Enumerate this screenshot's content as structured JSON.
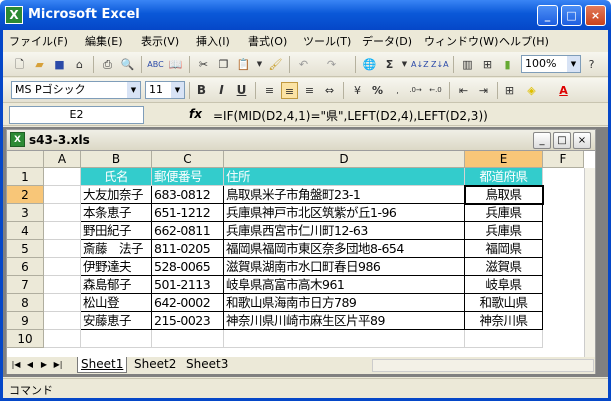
{
  "app": {
    "title": "Microsoft Excel",
    "icon_label": "X"
  },
  "window_buttons": {
    "minimize": "_",
    "maximize": "□",
    "close": "×"
  },
  "menu": [
    "ファイル(F)",
    "編集(E)",
    "表示(V)",
    "挿入(I)",
    "書式(O)",
    "ツール(T)",
    "データ(D)",
    "ウィンドウ(W)",
    "ヘルプ(H)"
  ],
  "toolbar": {
    "zoom": "100%",
    "sigma": "Σ"
  },
  "format_toolbar": {
    "font": "MS Pゴシック",
    "size": "11",
    "bold": "B",
    "italic": "I",
    "underline": "U",
    "percent": "%",
    "font_color_label": "A"
  },
  "formula_bar": {
    "namebox": "E2",
    "fx": "fx",
    "formula": "=IF(MID(D2,4,1)=\"県\",LEFT(D2,4),LEFT(D2,3))"
  },
  "workbook": {
    "title": "s43-3.xls",
    "icon_label": "X"
  },
  "columns": [
    "A",
    "B",
    "C",
    "D",
    "E",
    "F"
  ],
  "rows": [
    "1",
    "2",
    "3",
    "4",
    "5",
    "6",
    "7",
    "8",
    "9",
    "10"
  ],
  "table": {
    "headers": [
      "氏名",
      "郵便番号",
      "住所",
      "都道府県"
    ],
    "data": [
      [
        "大友加奈子",
        "683-0812",
        "鳥取県米子市角盤町23-1",
        "鳥取県"
      ],
      [
        "本条恵子",
        "651-1212",
        "兵庫県神戸市北区筑紫が丘1-96",
        "兵庫県"
      ],
      [
        "野田紀子",
        "662-0811",
        "兵庫県西宮市仁川町12-63",
        "兵庫県"
      ],
      [
        "斎藤　法子",
        "811-0205",
        "福岡県福岡市東区奈多団地8-654",
        "福岡県"
      ],
      [
        "伊野達夫",
        "528-0065",
        "滋賀県湖南市水口町春日986",
        "滋賀県"
      ],
      [
        "森島郁子",
        "501-2113",
        "岐阜県高富市高木961",
        "岐阜県"
      ],
      [
        "松山登",
        "642-0002",
        "和歌山県海南市日方789",
        "和歌山県"
      ],
      [
        "安藤恵子",
        "215-0023",
        "神奈川県川崎市麻生区片平89",
        "神奈川県"
      ]
    ]
  },
  "sheets": [
    "Sheet1",
    "Sheet2",
    "Sheet3"
  ],
  "status": "コマンド",
  "colors": {
    "header_fill": "#33cccc",
    "selected_header": "#f8c678",
    "title_bar": "#0a58d8"
  }
}
